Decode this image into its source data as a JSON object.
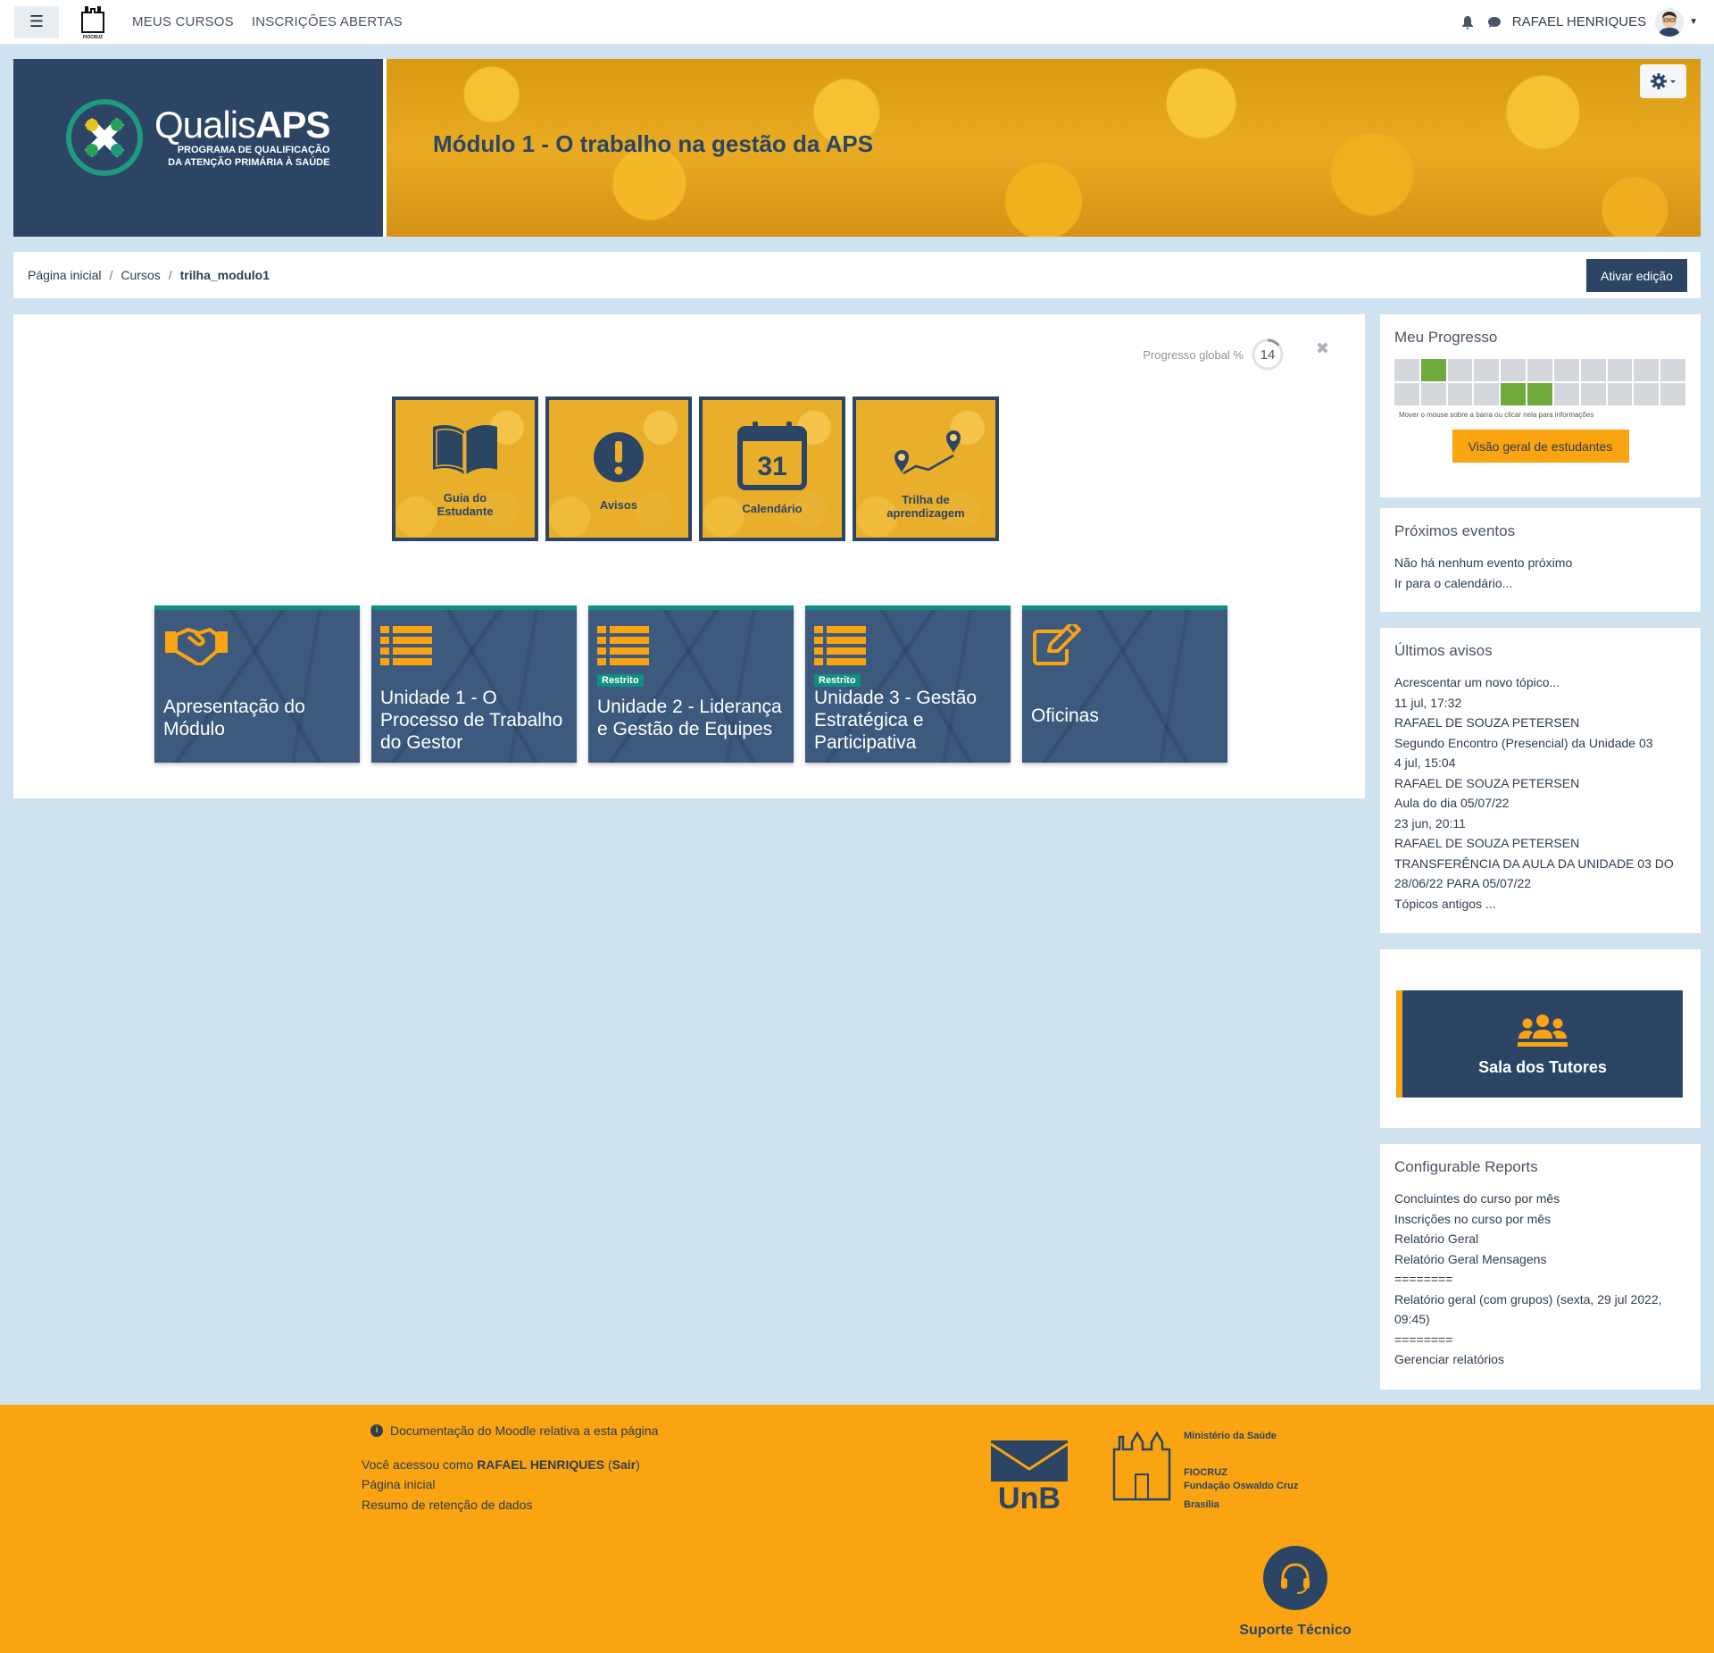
{
  "navbar": {
    "menu_icon": "hamburger-icon",
    "org_logo_text": "FIOCRUZ",
    "links": [
      "MEUS CURSOS",
      "INSCRIÇÕES ABERTAS"
    ],
    "user_name": "RAFAEL HENRIQUES"
  },
  "banner": {
    "logo_word_light": "Qualis",
    "logo_word_bold": "APS",
    "logo_sub_1": "PROGRAMA DE QUALIFICAÇÃO",
    "logo_sub_2": "DA ATENÇÃO PRIMÁRIA À SAÚDE",
    "title": "Módulo 1 - O trabalho na gestão da APS",
    "settings_icon": "gear-icon"
  },
  "breadcrumb": {
    "items": [
      "Página inicial",
      "Cursos",
      "trilha_modulo1"
    ],
    "edit_button": "Ativar edição"
  },
  "main": {
    "progress_label": "Progresso global %",
    "progress_value": "14",
    "progress_fraction": 0.14,
    "tiles": [
      {
        "label_1": "Guia do",
        "label_2": "Estudante",
        "icon": "book-icon"
      },
      {
        "label_1": "Avisos",
        "label_2": "",
        "icon": "alert-icon"
      },
      {
        "label_1": "Calendário",
        "label_2": "",
        "icon": "calendar-icon",
        "calendar_number": "31"
      },
      {
        "label_1": "Trilha de",
        "label_2": "aprendizagem",
        "icon": "route-icon"
      }
    ],
    "topics": [
      {
        "label": "Apresentação do Módulo",
        "icon": "handshake-icon",
        "restricted": ""
      },
      {
        "label": "Unidade 1 - O Processo de Trabalho do Gestor",
        "icon": "list-icon",
        "restricted": ""
      },
      {
        "label": "Unidade 2 - Liderança e Gestão de Equipes",
        "icon": "list-icon",
        "restricted": "Restrito"
      },
      {
        "label": "Unidade 3 - Gestão Estratégica e Participativa",
        "icon": "list-icon",
        "restricted": "Restrito"
      },
      {
        "label": "Oficinas",
        "icon": "edit-icon",
        "restricted": ""
      }
    ]
  },
  "sidebar": {
    "progress": {
      "title": "Meu Progresso",
      "hint": "Mover o mouse sobre a barra ou clicar nela para informações",
      "button": "Visão geral de estudantes",
      "completed_cells": [
        1,
        15,
        16
      ]
    },
    "events": {
      "title": "Próximos eventos",
      "empty": "Não há nenhum evento próximo",
      "link": "Ir para o calendário..."
    },
    "news": {
      "title": "Últimos avisos",
      "lines": [
        "Acrescentar um novo tópico...",
        "11 jul, 17:32",
        "RAFAEL DE SOUZA PETERSEN",
        "Segundo Encontro (Presencial) da Unidade 03",
        "4 jul, 15:04",
        "RAFAEL DE SOUZA PETERSEN",
        "Aula do dia 05/07/22",
        "23 jun, 20:11",
        "RAFAEL DE SOUZA PETERSEN",
        "TRANSFERÊNCIA DA AULA DA UNIDADE 03 DO 28/06/22 PARA 05/07/22",
        "Tópicos antigos ..."
      ]
    },
    "tutors": {
      "label": "Sala dos Tutores",
      "icon": "users-icon"
    },
    "reports": {
      "title": "Configurable Reports",
      "lines": [
        "Concluintes do curso por mês",
        "Inscrições no curso por mês",
        "Relatório Geral",
        "Relatório Geral Mensagens",
        "========",
        "Relatório geral (com grupos) (sexta, 29 jul 2022, 09:45)",
        "========",
        "Gerenciar relatórios"
      ]
    }
  },
  "footer": {
    "doc_link": "Documentação do Moodle relativa a esta página",
    "access_prefix": "Você acessou como",
    "access_user": "RAFAEL HENRIQUES",
    "logout_open": "(",
    "logout": "Sair",
    "logout_close": ")",
    "home": "Página inicial",
    "retention": "Resumo de retenção de dados",
    "unb": "UnB",
    "ministry": "Ministério da Saúde",
    "fiocruz_1": "FIOCRUZ",
    "fiocruz_2": "Fundação Oswaldo Cruz",
    "fiocruz_3": "Brasília",
    "support": "Suporte Técnico"
  },
  "colors": {
    "navy": "#2c4565",
    "orange": "#f9a410",
    "teal": "#0f8f80",
    "progress_done": "#6fab3c"
  }
}
